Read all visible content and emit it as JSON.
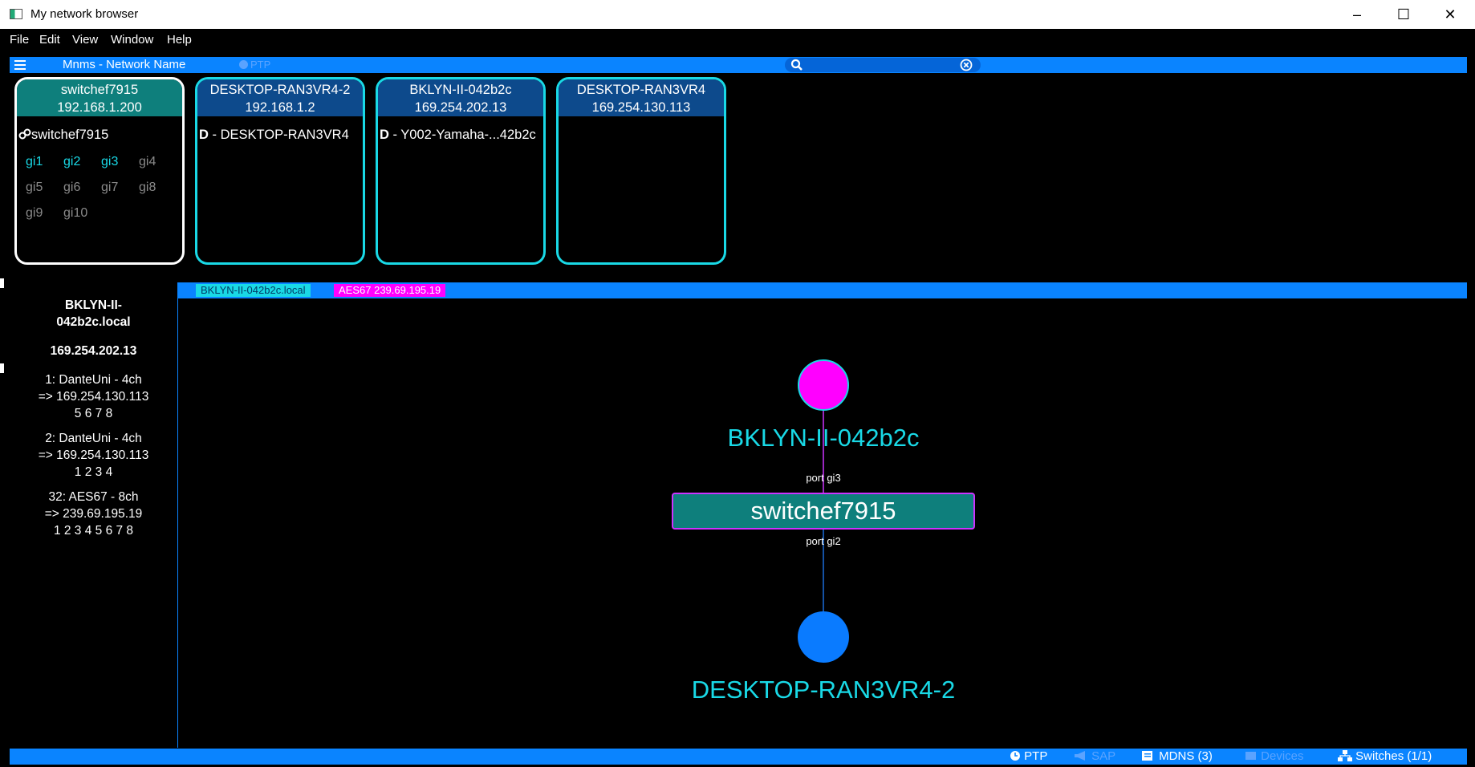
{
  "window": {
    "title": "My network browser",
    "minimize": "–",
    "maximize": "☐",
    "close": "✕"
  },
  "menu": [
    "File",
    "Edit",
    "View",
    "Window",
    "Help"
  ],
  "toolbar": {
    "network_name": "Mnms - Network Name",
    "ptp_label": "PTP",
    "search_placeholder": ""
  },
  "devices": [
    {
      "name": "switchef7915",
      "ip": "192.168.1.200",
      "line_icon": "link-icon",
      "line": "switchef7915",
      "ports": [
        {
          "label": "gi1",
          "active": true
        },
        {
          "label": "gi2",
          "active": true
        },
        {
          "label": "gi3",
          "active": true
        },
        {
          "label": "gi4",
          "active": false
        },
        {
          "label": "gi5",
          "active": false
        },
        {
          "label": "gi6",
          "active": false
        },
        {
          "label": "gi7",
          "active": false
        },
        {
          "label": "gi8",
          "active": false
        },
        {
          "label": "gi9",
          "active": false
        },
        {
          "label": "gi10",
          "active": false
        }
      ]
    },
    {
      "name": "DESKTOP-RAN3VR4-2",
      "ip": "192.168.1.2",
      "line_icon": "dante-icon",
      "line": " - DESKTOP-RAN3VR4"
    },
    {
      "name": "BKLYN-II-042b2c",
      "ip": "169.254.202.13",
      "line_icon": "dante-icon",
      "line": " - Y002-Yamaha-...42b2c"
    },
    {
      "name": "DESKTOP-RAN3VR4",
      "ip": "169.254.130.113"
    }
  ],
  "details": {
    "hostname_line1": "BKLYN-II-",
    "hostname_line2": "042b2c.local",
    "ip": "169.254.202.13",
    "flows": [
      {
        "title": "1: DanteUni - 4ch",
        "target": "=> 169.254.130.113",
        "channels": "5 6 7 8"
      },
      {
        "title": "2: DanteUni - 4ch",
        "target": "=> 169.254.130.113",
        "channels": "1 2 3 4"
      },
      {
        "title": "32: AES67 - 8ch",
        "target": "=> 239.69.195.19",
        "channels": "1 2 3 4 5 6 7 8"
      }
    ]
  },
  "tabs": {
    "host": "BKLYN-II-042b2c.local",
    "stream": "AES67 239.69.195.19"
  },
  "graph": {
    "top_node": "BKLYN-II-042b2c",
    "switch_node": "switchef7915",
    "port_top": "port gi3",
    "port_bottom": "port gi2",
    "bottom_node": "DESKTOP-RAN3VR4-2",
    "colors": {
      "top_node": "#ff00ff",
      "bottom_node": "#0a7bff",
      "switch": "#0e7f7c",
      "switch_border": "#cc33ff",
      "label": "#19d9e6",
      "edge_top": "#cc33ff",
      "edge_bottom": "#1a6cd9"
    }
  },
  "status": {
    "ptp": "PTP",
    "sap": "SAP",
    "mdns": "MDNS (3)",
    "devices": "Devices",
    "switches": "Switches (1/1)"
  }
}
